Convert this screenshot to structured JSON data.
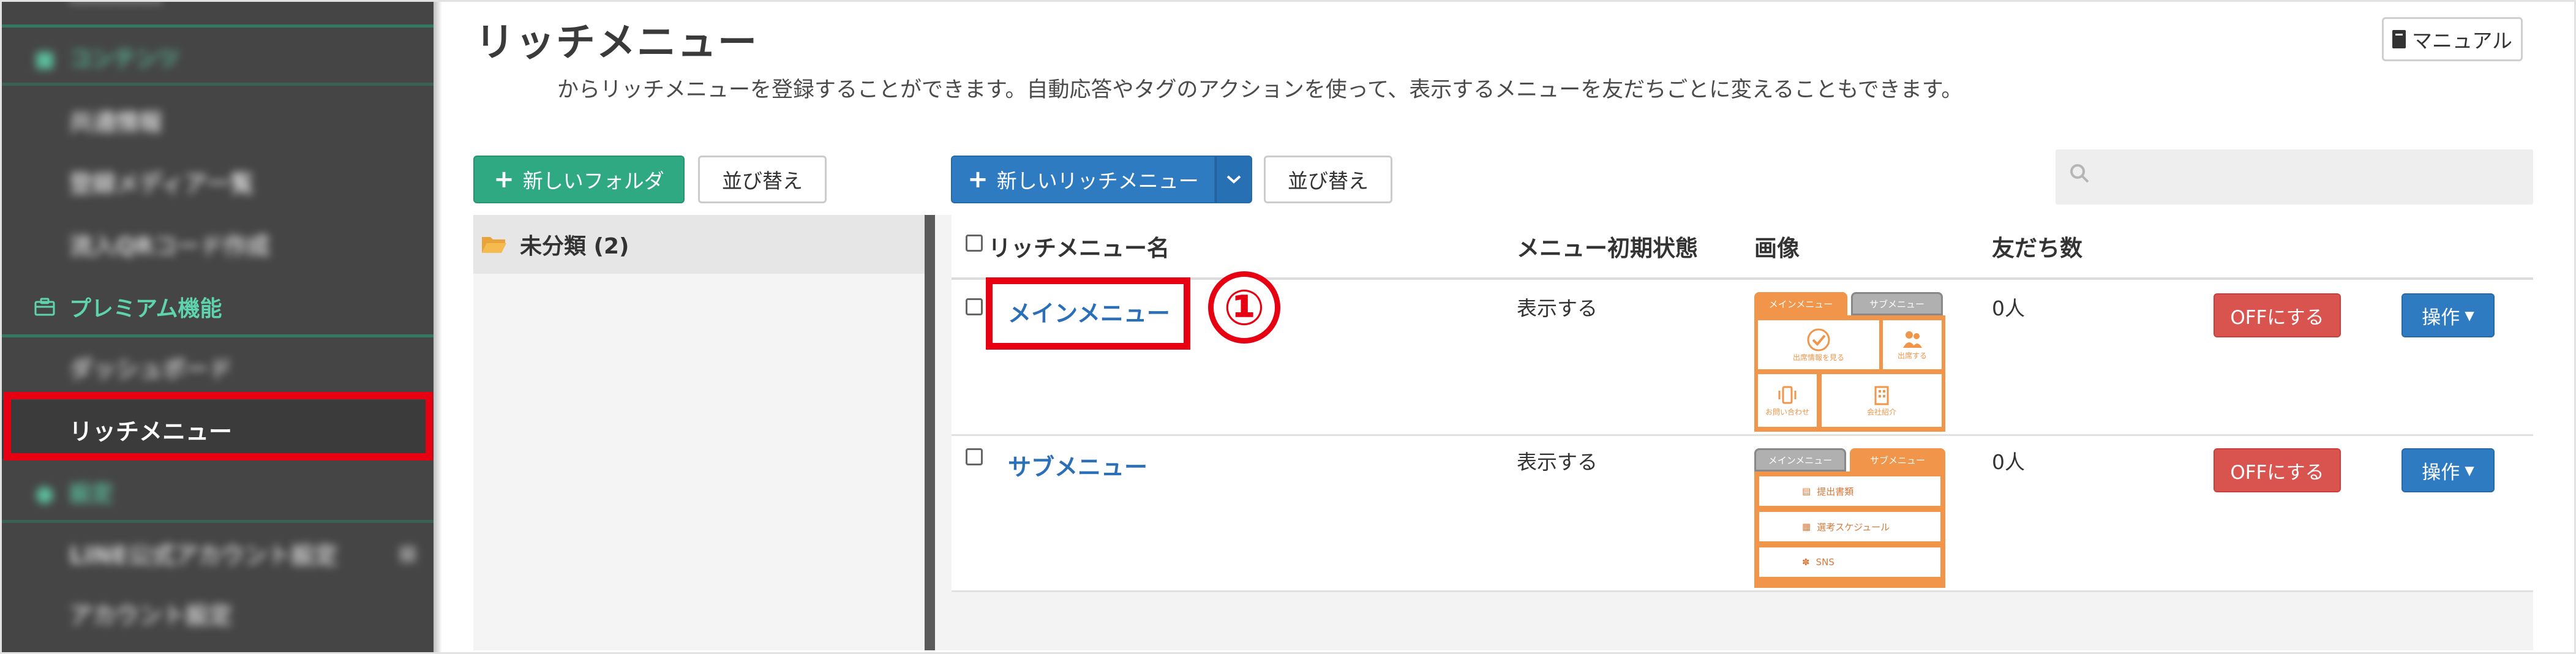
{
  "sidebar": {
    "blurred_top": "…………",
    "contents_header": "コンテンツ",
    "contents_items": [
      "共通情報",
      "登録メディア一覧",
      "流入QRコード作成"
    ],
    "premium_header": "プレミアム機能",
    "premium_items": [
      "ダッシュボード",
      "リッチメニュー"
    ],
    "settings_header": "設定",
    "settings_items": [
      "LINE公式アカウント設定",
      "アカウント設定"
    ],
    "active_item": "リッチメニュー"
  },
  "header": {
    "title": "リッチメニュー",
    "description": "からリッチメニューを登録することができます。自動応答やタグのアクションを使って、表示するメニューを友だちごとに変えることもできます。",
    "manual_button": "マニュアル"
  },
  "toolbar": {
    "new_folder": "新しいフォルダ",
    "sort_folders": "並び替え",
    "new_rich_menu": "新しいリッチメニュー",
    "sort_menus": "並び替え",
    "search_placeholder": ""
  },
  "folders": [
    {
      "label": "未分類 (2)"
    }
  ],
  "table": {
    "columns": [
      "リッチメニュー名",
      "メニュー初期状態",
      "画像",
      "友だち数"
    ],
    "rows": [
      {
        "name": "メインメニュー",
        "initial_state": "表示する",
        "friends": "0人",
        "off_button": "OFFにする",
        "ops_button": "操作",
        "thumb_tabs": [
          "メインメニュー",
          "サブメニュー"
        ],
        "thumb_tiles": [
          "出席情報を見る",
          "出席する",
          "お問い合わせ",
          "会社紹介"
        ]
      },
      {
        "name": "サブメニュー",
        "initial_state": "表示する",
        "friends": "0人",
        "off_button": "OFFにする",
        "ops_button": "操作",
        "thumb_tabs": [
          "メインメニュー",
          "サブメニュー"
        ],
        "thumb_bars": [
          "提出書類",
          "選考スケジュール",
          "SNS"
        ]
      }
    ]
  },
  "annotation": {
    "step_number": "①"
  },
  "colors": {
    "sidebar_bg": "#454545",
    "sidebar_accent": "#5fd3ad",
    "highlight_red": "#e60012",
    "primary_blue": "#2e7bc1",
    "success_green": "#2fa982",
    "danger_red": "#d9534f",
    "thumb_orange": "#f0954a"
  }
}
